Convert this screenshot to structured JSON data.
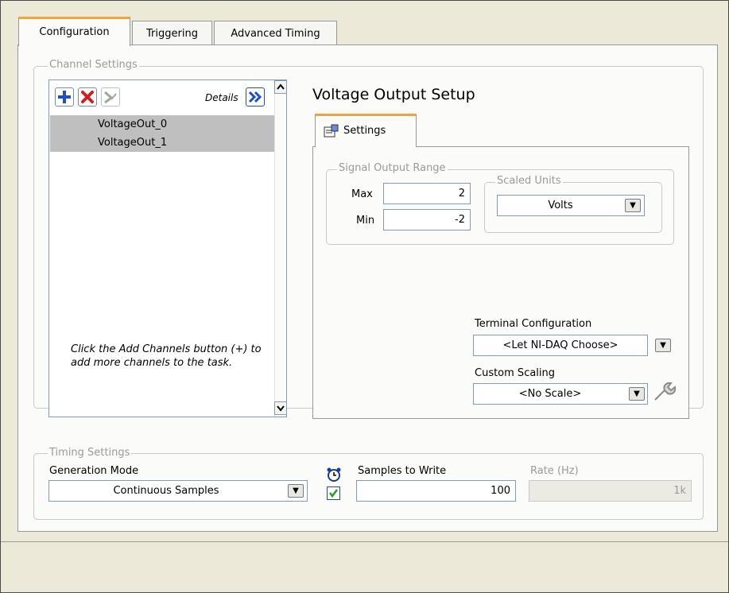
{
  "tabs": [
    {
      "label": "Configuration",
      "active": true
    },
    {
      "label": "Triggering",
      "active": false
    },
    {
      "label": "Advanced Timing",
      "active": false
    }
  ],
  "channel_settings": {
    "legend": "Channel Settings",
    "details_label": "Details",
    "channels": [
      "VoltageOut_0",
      "VoltageOut_1"
    ],
    "hint": "Click the Add Channels button (+) to add more channels to the task."
  },
  "voltage_setup": {
    "title": "Voltage Output Setup",
    "settings_tab": "Settings",
    "signal_range_legend": "Signal Output Range",
    "max_label": "Max",
    "max_value": "2",
    "min_label": "Min",
    "min_value": "-2",
    "scaled_units_legend": "Scaled Units",
    "scaled_units_value": "Volts",
    "terminal_config_label": "Terminal Configuration",
    "terminal_config_value": "<Let NI-DAQ Choose>",
    "custom_scaling_label": "Custom Scaling",
    "custom_scaling_value": "<No Scale>"
  },
  "timing": {
    "legend": "Timing Settings",
    "generation_mode_label": "Generation Mode",
    "generation_mode_value": "Continuous Samples",
    "samples_label": "Samples to Write",
    "samples_value": "100",
    "rate_label": "Rate (Hz)",
    "rate_value": "1k"
  },
  "colors": {
    "tab_accent": "#f2a43a",
    "selection": "#bfbfbf",
    "field_border": "#7f9db9"
  }
}
